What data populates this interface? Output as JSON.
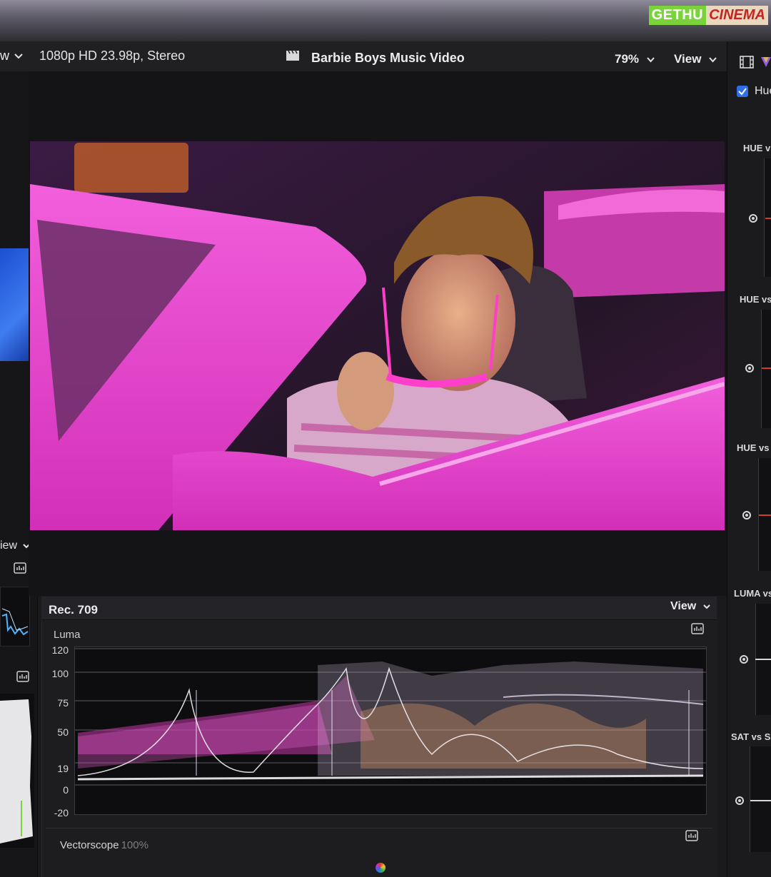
{
  "watermark": {
    "part_a": "GETHU",
    "part_b": "CINEMA"
  },
  "left_panel": {
    "header_fragment": "w",
    "view_label": "iew"
  },
  "viewer": {
    "format": "1080p HD 23.98p, Stereo",
    "project_title": "Barbie Boys Music Video",
    "zoom": "79%",
    "view_label": "View"
  },
  "scopes": {
    "color_space": "Rec. 709",
    "view_label": "View",
    "waveform_label": "Luma",
    "axis_ticks": [
      "120",
      "100",
      "75",
      "50",
      "19",
      "0",
      "-20"
    ],
    "vectorscope_label": "Vectorscope",
    "vectorscope_pct": "100%"
  },
  "inspector": {
    "checkbox_label": "Hue",
    "curves": [
      {
        "title": "HUE vs"
      },
      {
        "title": "HUE vs"
      },
      {
        "title": "HUE vs"
      },
      {
        "title": "LUMA vs"
      },
      {
        "title": "SAT vs SA"
      }
    ]
  },
  "colors": {
    "accent": "#2f6fe6",
    "curve_red": "#d53b2c",
    "pink_car": "#e93fd0"
  }
}
